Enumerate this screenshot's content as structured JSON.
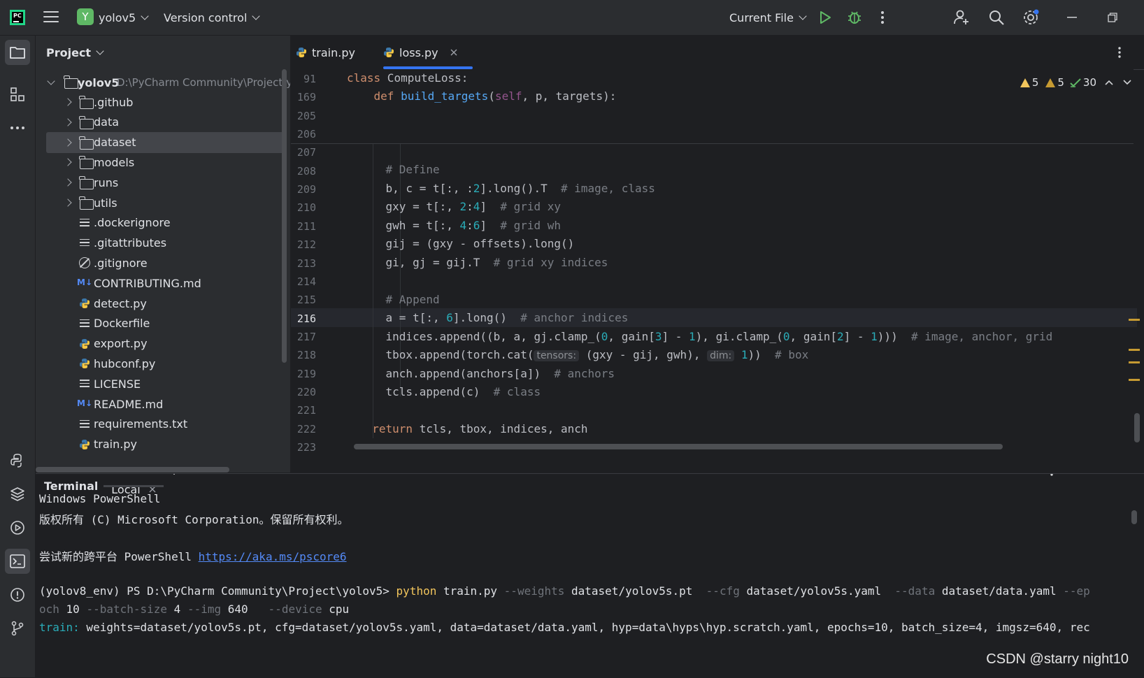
{
  "titlebar": {
    "project_initial": "Y",
    "project_name": "yolov5",
    "vcs_label": "Version control",
    "run_config": "Current File"
  },
  "project_panel": {
    "title": "Project",
    "root_name": "yolov5",
    "root_path": "D:\\PyCharm Community\\Project\\yolov5",
    "items": [
      {
        "name": ".github",
        "kind": "folder"
      },
      {
        "name": "data",
        "kind": "folder"
      },
      {
        "name": "dataset",
        "kind": "folder"
      },
      {
        "name": "models",
        "kind": "package"
      },
      {
        "name": "runs",
        "kind": "folder"
      },
      {
        "name": "utils",
        "kind": "package"
      },
      {
        "name": ".dockerignore",
        "kind": "text"
      },
      {
        "name": ".gitattributes",
        "kind": "text"
      },
      {
        "name": ".gitignore",
        "kind": "ignore"
      },
      {
        "name": "CONTRIBUTING.md",
        "kind": "markdown"
      },
      {
        "name": "detect.py",
        "kind": "python"
      },
      {
        "name": "Dockerfile",
        "kind": "text"
      },
      {
        "name": "export.py",
        "kind": "python"
      },
      {
        "name": "hubconf.py",
        "kind": "python"
      },
      {
        "name": "LICENSE",
        "kind": "text"
      },
      {
        "name": "README.md",
        "kind": "markdown"
      },
      {
        "name": "requirements.txt",
        "kind": "text"
      },
      {
        "name": "train.py",
        "kind": "python"
      }
    ]
  },
  "editor": {
    "tabs": [
      {
        "label": "train.py",
        "active": false
      },
      {
        "label": "loss.py",
        "active": true
      }
    ],
    "inspections": {
      "warnings_a": "5",
      "warnings_b": "5",
      "ok": "30"
    },
    "line_numbers": [
      "91",
      "169",
      "205",
      "206",
      "207",
      "208",
      "209",
      "210",
      "211",
      "212",
      "213",
      "214",
      "215",
      "216",
      "217",
      "218",
      "219",
      "220",
      "221",
      "222",
      "223"
    ],
    "current_line": "216"
  },
  "terminal": {
    "title": "Terminal",
    "tab": "Local",
    "lines": {
      "l1": "Windows PowerShell",
      "l2": "版权所有 (C) Microsoft Corporation。保留所有权利。",
      "l3_prefix": "尝试新的跨平台 PowerShell ",
      "l3_link": "https://aka.ms/pscore6",
      "prompt": "(yolov8_env) PS D:\\PyCharm Community\\Project\\yolov5> ",
      "cmd_python": "python",
      "cmd_script": " train.py ",
      "opt_weights": "--weights",
      "val_weights": " dataset/yolov5s.pt  ",
      "opt_cfg": "--cfg",
      "val_cfg": " dataset/yolov5s.yaml  ",
      "opt_data": "--data",
      "val_data": " dataset/data.yaml ",
      "opt_epoch_a": "--ep",
      "opt_epoch_b": "och",
      "val_epoch": " 10 ",
      "opt_batch": "--batch-size",
      "val_batch": " 4 ",
      "opt_img": "--img",
      "val_img": " 640   ",
      "opt_device": "--device",
      "val_device": " cpu",
      "train_kw": "train:",
      "train_rest": " weights=dataset/yolov5s.pt, cfg=dataset/yolov5s.yaml, data=dataset/data.yaml, hyp=data\\hyps\\hyp.scratch.yaml, epochs=10, batch_size=4, imgsz=640, rec"
    }
  },
  "watermark": "CSDN @starry night10"
}
